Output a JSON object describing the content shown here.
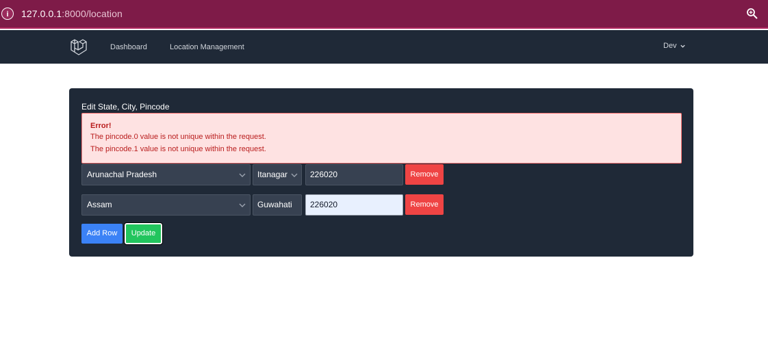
{
  "browser": {
    "url_host": "127.0.0.1",
    "url_rest": ":8000/location"
  },
  "nav": {
    "links": [
      "Dashboard",
      "Location Management"
    ],
    "user": "Dev"
  },
  "card": {
    "title": "Edit State, City, Pincode",
    "alert": {
      "title": "Error!",
      "messages": [
        "The pincode.0 value is not unique within the request.",
        "The pincode.1 value is not unique within the request."
      ]
    },
    "rows": [
      {
        "state": "Arunachal Pradesh",
        "city": "Itanagar",
        "pincode": "226020",
        "remove_label": "Remove"
      },
      {
        "state": "Assam",
        "city": "Guwahati",
        "pincode": "226020",
        "remove_label": "Remove"
      }
    ],
    "add_row_label": "Add Row",
    "update_label": "Update"
  }
}
